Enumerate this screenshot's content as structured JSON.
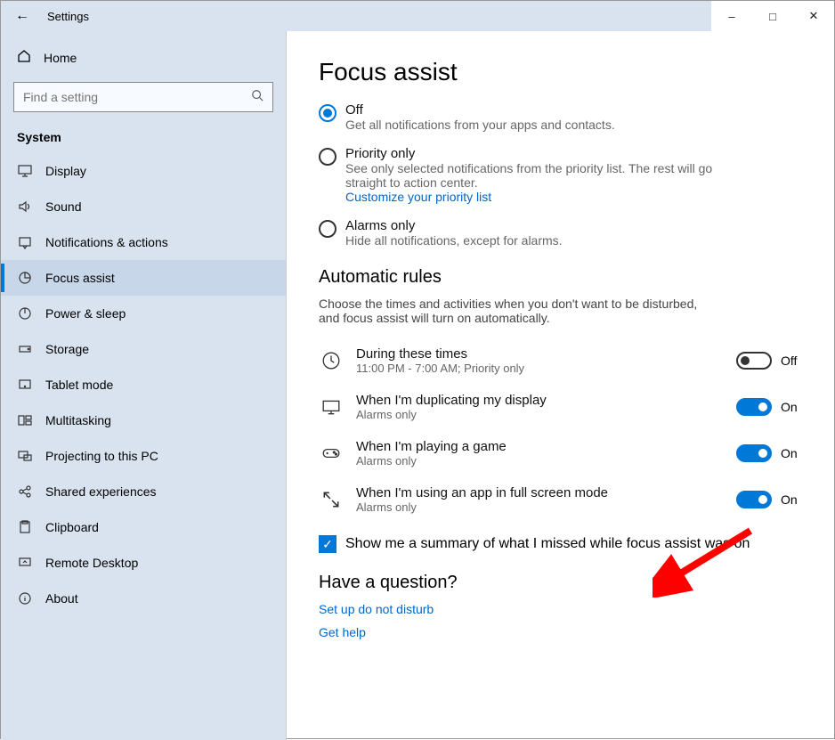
{
  "window": {
    "title": "Settings"
  },
  "sidebar": {
    "home": "Home",
    "search_placeholder": "Find a setting",
    "section": "System",
    "items": [
      {
        "icon": "display",
        "label": "Display"
      },
      {
        "icon": "sound",
        "label": "Sound"
      },
      {
        "icon": "notifications",
        "label": "Notifications & actions"
      },
      {
        "icon": "focus",
        "label": "Focus assist",
        "selected": true
      },
      {
        "icon": "power",
        "label": "Power & sleep"
      },
      {
        "icon": "storage",
        "label": "Storage"
      },
      {
        "icon": "tablet",
        "label": "Tablet mode"
      },
      {
        "icon": "multitask",
        "label": "Multitasking"
      },
      {
        "icon": "project",
        "label": "Projecting to this PC"
      },
      {
        "icon": "shared",
        "label": "Shared experiences"
      },
      {
        "icon": "clipboard",
        "label": "Clipboard"
      },
      {
        "icon": "remote",
        "label": "Remote Desktop"
      },
      {
        "icon": "about",
        "label": "About"
      }
    ]
  },
  "main": {
    "title": "Focus assist",
    "radios": {
      "off": {
        "label": "Off",
        "desc": "Get all notifications from your apps and contacts."
      },
      "priority": {
        "label": "Priority only",
        "desc": "See only selected notifications from the priority list. The rest will go straight to action center.",
        "link": "Customize your priority list"
      },
      "alarms": {
        "label": "Alarms only",
        "desc": "Hide all notifications, except for alarms."
      }
    },
    "rules_title": "Automatic rules",
    "rules_desc": "Choose the times and activities when you don't want to be disturbed, and focus assist will turn on automatically.",
    "rules": [
      {
        "icon": "clock",
        "label": "During these times",
        "desc": "11:00 PM - 7:00 AM; Priority only",
        "on": false,
        "state": "Off"
      },
      {
        "icon": "monitor",
        "label": "When I'm duplicating my display",
        "desc": "Alarms only",
        "on": true,
        "state": "On"
      },
      {
        "icon": "game",
        "label": "When I'm playing a game",
        "desc": "Alarms only",
        "on": true,
        "state": "On"
      },
      {
        "icon": "fullscreen",
        "label": "When I'm using an app in full screen mode",
        "desc": "Alarms only",
        "on": true,
        "state": "On"
      }
    ],
    "checkbox_label": "Show me a summary of what I missed while focus assist was on",
    "question_title": "Have a question?",
    "link1": "Set up do not disturb",
    "link2": "Get help"
  }
}
